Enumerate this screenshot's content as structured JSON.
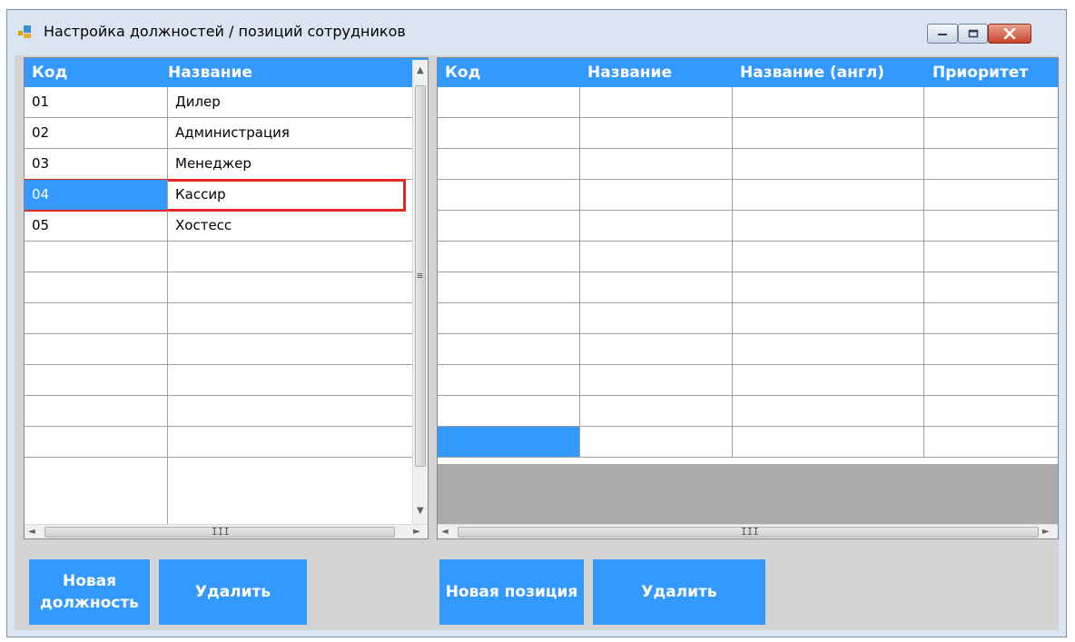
{
  "window": {
    "title": "Настройка должностей / позиций сотрудников",
    "minimize_icon": "minimize-icon",
    "maximize_icon": "maximize-icon",
    "close_icon": "close-icon"
  },
  "colors": {
    "header": "#3399ff",
    "selection": "#3399ff",
    "highlight_border": "#e52727",
    "button": "#3399ff"
  },
  "positions_grid": {
    "columns": [
      "Код",
      "Название"
    ],
    "rows": [
      {
        "code": "01",
        "name": "Дилер"
      },
      {
        "code": "02",
        "name": "Администрация"
      },
      {
        "code": "03",
        "name": "Менеджер"
      },
      {
        "code": "04",
        "name": "Кассир",
        "selected": true
      },
      {
        "code": "05",
        "name": "Хостесс"
      }
    ],
    "empty_rows": 7,
    "scroll_grip": "≡",
    "h_grip": "III"
  },
  "roles_grid": {
    "columns": [
      "Код",
      "Название",
      "Название (англ)",
      "Приоритет"
    ],
    "empty_rows": 11,
    "h_grip": "III"
  },
  "buttons": {
    "new_position": "Новая должность",
    "delete_left": "Удалить",
    "new_role": "Новая позиция",
    "delete_right": "Удалить"
  }
}
